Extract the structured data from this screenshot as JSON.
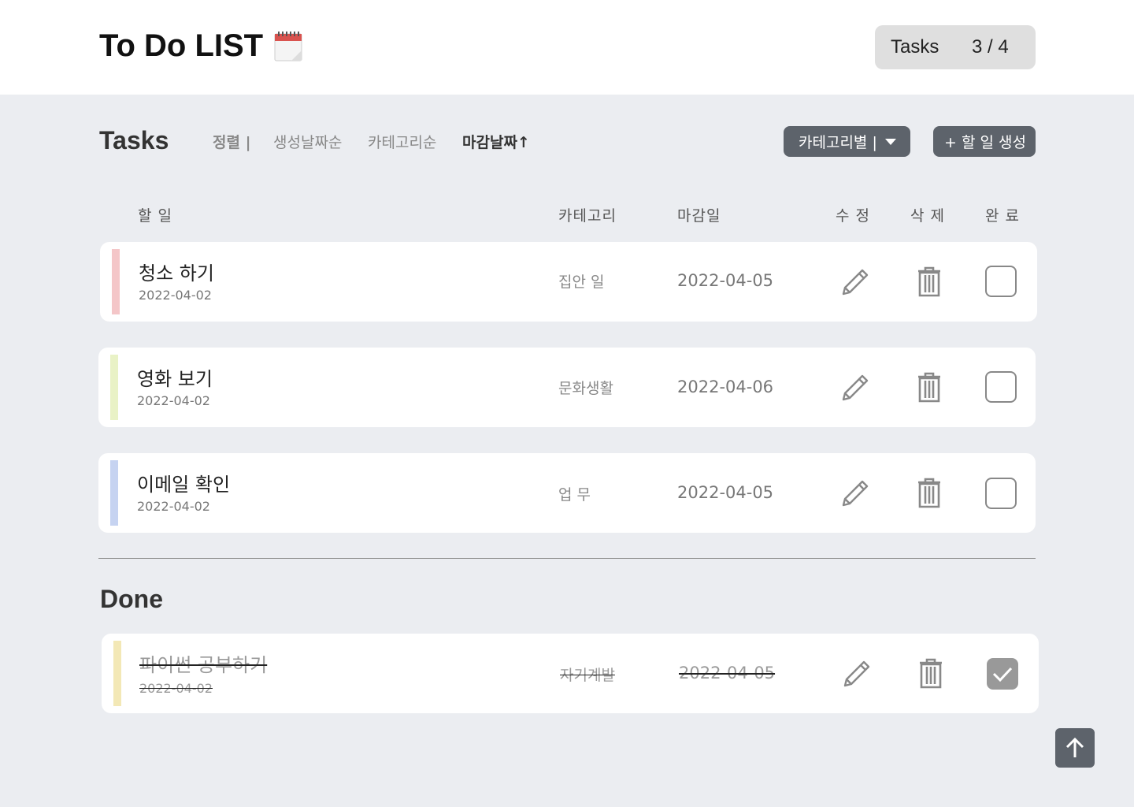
{
  "header": {
    "title": "To Do LIST",
    "title_icon": "calendar-icon",
    "counter_label": "Tasks",
    "counter_value": "3 / 4"
  },
  "tasks_section": {
    "title": "Tasks",
    "sort_label": "정렬 |",
    "sort_options": [
      "생성날짜순",
      "카테고리순",
      "마감날짜↑"
    ],
    "active_sort": "마감날짜↑",
    "category_filter_label": "카테고리별 |",
    "add_button_label": "+ 할 일 생성",
    "columns": {
      "task": "할 일",
      "category": "카테고리",
      "due": "마감일",
      "edit": "수 정",
      "delete": "삭 제",
      "done": "완 료"
    },
    "items": [
      {
        "name": "청소 하기",
        "created": "2022-04-02",
        "category": "집안 일",
        "due": "2022-04-05",
        "color": "#f4c6c8",
        "completed": false
      },
      {
        "name": "영화 보기",
        "created": "2022-04-02",
        "category": "문화생활",
        "due": "2022-04-06",
        "color": "#e9f2c6",
        "completed": false
      },
      {
        "name": "이메일 확인",
        "created": "2022-04-02",
        "category": "업 무",
        "due": "2022-04-05",
        "color": "#c6d3f1",
        "completed": false
      }
    ]
  },
  "done_section": {
    "title": "Done",
    "items": [
      {
        "name": "파이썬 공부하기",
        "created": "2022-04-02",
        "category": "자기계발",
        "due": "2022-04-05",
        "color": "#f3e8b6",
        "completed": true
      }
    ]
  },
  "icons": {
    "edit": "pencil-icon",
    "delete": "trash-icon",
    "scroll_top": "arrow-up-icon",
    "check": "check-icon"
  },
  "colors": {
    "button_dark": "#5d636b",
    "background": "#ebedf1",
    "counter_bg": "#dfdfdf"
  }
}
